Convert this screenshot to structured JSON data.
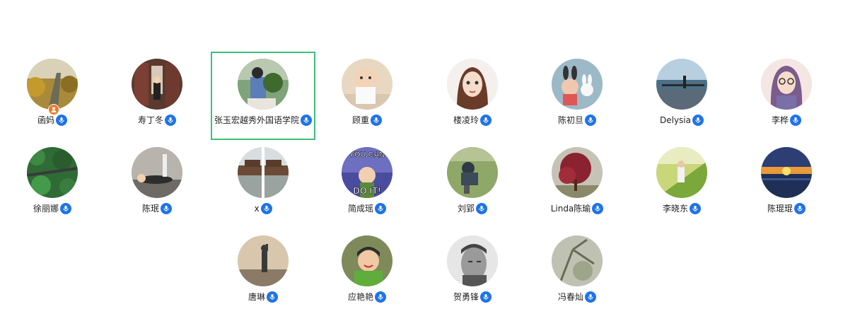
{
  "colors": {
    "mic_badge": "#1f73e8",
    "selected_border": "#3cc07b",
    "host_badge": "#f07a26"
  },
  "participants": [
    {
      "name": "函妈",
      "icon": "mic-icon",
      "host_badge": "person-icon"
    },
    {
      "name": "寿丁冬",
      "icon": "mic-icon"
    },
    {
      "name": "张玉宏越秀外国语学院",
      "icon": "mic-icon",
      "selected": true
    },
    {
      "name": "顾重",
      "icon": "mic-icon"
    },
    {
      "name": "楼凌玲",
      "icon": "mic-icon"
    },
    {
      "name": "陈初旦",
      "icon": "mic-icon"
    },
    {
      "name": "Delysia",
      "icon": "mic-icon"
    },
    {
      "name": "李桦",
      "icon": "mic-icon"
    },
    {
      "name": "徐丽娜",
      "icon": "mic-icon"
    },
    {
      "name": "陈珉",
      "icon": "mic-icon"
    },
    {
      "name": "x",
      "icon": "mic-icon"
    },
    {
      "name": "简成瑶",
      "icon": "mic-icon",
      "avatar_text": [
        "YOU CAN",
        "DO IT!"
      ]
    },
    {
      "name": "刘郢",
      "icon": "mic-icon"
    },
    {
      "name": "Linda陈瑜",
      "icon": "mic-icon"
    },
    {
      "name": "李晓东",
      "icon": "mic-icon"
    },
    {
      "name": "陈琨琨",
      "icon": "mic-icon"
    },
    {
      "name": "唐琳",
      "icon": "mic-icon"
    },
    {
      "name": "应艳艳",
      "icon": "mic-icon"
    },
    {
      "name": "贺勇锋",
      "icon": "mic-icon"
    },
    {
      "name": "冯春灿",
      "icon": "mic-icon"
    }
  ]
}
